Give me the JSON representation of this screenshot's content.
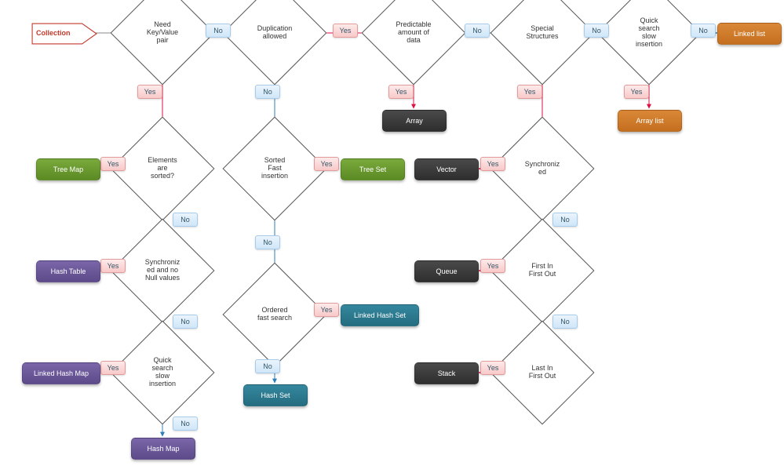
{
  "start": "Collection",
  "diamonds": {
    "key_value": "Need\nKey/Value\npair",
    "duplication": "Duplication\nallowed",
    "predictable": "Predictable\namount of\ndata",
    "special": "Special\nStructures",
    "quick_search_r": "Quick\nsearch\nslow\ninsertion",
    "elements_sorted": "Elements\nare\nsorted?",
    "sorted_fast_ins": "Sorted\nFast\ninsertion",
    "sync_no_null": "Synchroniz\ned and no\nNull values",
    "synchronized": "Synchroniz\ned",
    "ordered_fast": "Ordered\nfast search",
    "fifo": "First In\nFirst Out",
    "lifo": "Last In\nFirst Out",
    "quick_search_l": "Quick\nsearch\nslow\ninsertion"
  },
  "labels": {
    "yes": "Yes",
    "no": "No"
  },
  "results": {
    "tree_map": "Tree Map",
    "hash_table": "Hash Table",
    "linked_hash_map": "Linked Hash Map",
    "hash_map": "Hash Map",
    "tree_set": "Tree Set",
    "linked_hash_set": "Linked Hash Set",
    "hash_set": "Hash Set",
    "array": "Array",
    "vector": "Vector",
    "queue": "Queue",
    "stack": "Stack",
    "linked_list": "Linked list",
    "array_list": "Array list"
  }
}
